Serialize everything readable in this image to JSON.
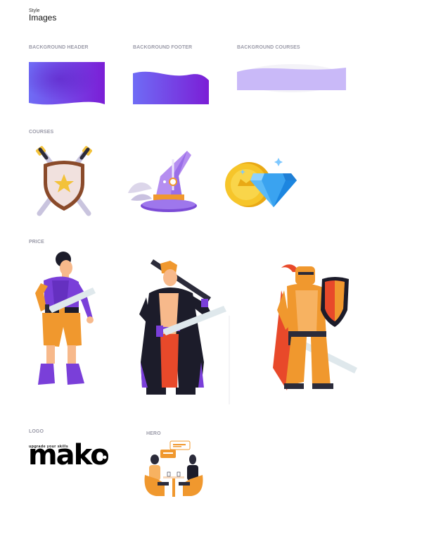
{
  "header": {
    "kicker": "Style",
    "title": "Images"
  },
  "sections": {
    "bg_header": "BACKGROUND HEADER",
    "bg_footer": "BACKGROUND FOOTER",
    "bg_courses": "BACKGROUND COURSES",
    "courses": "COURSES",
    "price": "PRICE",
    "logo": "LOGO",
    "hero": "HERO"
  },
  "logo": {
    "tagline": "upgrade your skills",
    "wordmark": "mako"
  },
  "icons": {
    "courses": [
      "shield-swords-icon",
      "wizard-hat-icon",
      "coin-diamond-icon"
    ],
    "price": [
      "adventurer-icon",
      "swordsman-icon",
      "knight-icon"
    ],
    "hero": "meeting-scene-icon"
  },
  "colors": {
    "primary": "#6a35e0",
    "accent_start": "#6f6cf5",
    "accent_end": "#7b1ed6",
    "orange": "#f0982e",
    "label": "#9a9aa8"
  }
}
